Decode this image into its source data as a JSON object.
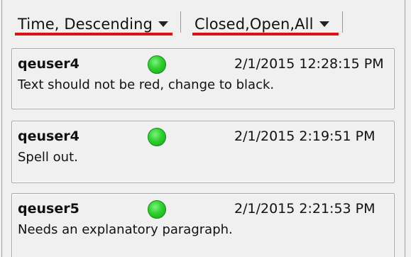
{
  "filters": {
    "sort": {
      "label": "Time, Descending",
      "icon": "chevron-down-icon"
    },
    "status": {
      "label": "Closed,Open,All",
      "icon": "chevron-down-icon"
    }
  },
  "comments": [
    {
      "user": "qeuser4",
      "time": "2/1/2015 12:28:15 PM",
      "text": "Text should not be red, change to black.",
      "status_color": "#2fcf2f"
    },
    {
      "user": "qeuser4",
      "time": "2/1/2015 2:19:51 PM",
      "text": "Spell out.",
      "status_color": "#2fcf2f"
    },
    {
      "user": "qeuser5",
      "time": "2/1/2015 2:21:53 PM",
      "text": "Needs an explanatory paragraph.",
      "status_color": "#2fcf2f"
    }
  ],
  "colors": {
    "annotation_underline": "#e01010",
    "status_open": "#2fcf2f"
  }
}
